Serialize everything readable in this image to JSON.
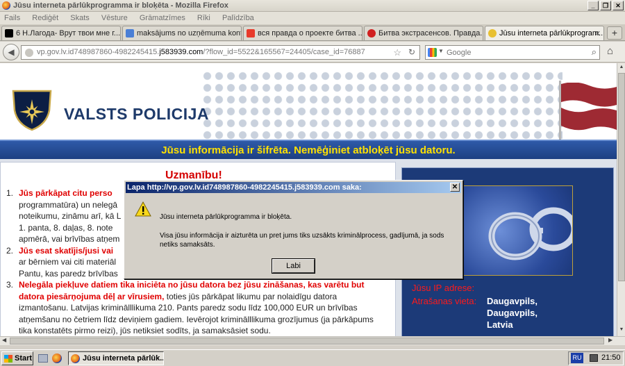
{
  "window": {
    "title": "Jūsu interneta pārlūkprogramma ir bloķēta - Mozilla Firefox",
    "buttons": [
      "_",
      "❐",
      "✕"
    ]
  },
  "menu": [
    "Fails",
    "Rediģēt",
    "Skats",
    "Vēsture",
    "Grāmatzīmes",
    "Rīki",
    "Palīdzība"
  ],
  "tabs": [
    {
      "label": "6 Н.Лагода- Врут твои мне г...",
      "icon_color": "#000000"
    },
    {
      "label": "maksājums no uzņēmuma kont...",
      "icon_color": "#4a7fd6"
    },
    {
      "label": "вся правда о проекте битва ...",
      "icon_color": "#e83a2a"
    },
    {
      "label": "Битва экстрасенсов. Правда...",
      "icon_color": "#d02020"
    },
    {
      "label": "Jūsu interneta pārlūkprogram...",
      "icon_color": "#e8c030"
    }
  ],
  "nav": {
    "url_prefix": "vp.gov.lv.id748987860-4982245415.",
    "url_domain": "j583939.com",
    "url_rest": "/?flow_id=5522&165567=24405/case_id=76887",
    "search_placeholder": "Google"
  },
  "page": {
    "org_name": "VALSTS POLICIJA",
    "banner": "Jūsu informācija ir šifrēta. Nemēģiniet atbloķēt jūsu datoru.",
    "warning_title": "Uzmanību!",
    "items": [
      {
        "num": "1.",
        "red": "Jūs pārkāpat citu perso",
        "lines": [
          "programmatūra) un nelegā",
          "noteikumu, zināmu arī, kā L",
          "1. panta, 8. daļas, 8. note",
          "apmērā, vai brīvības atņem"
        ]
      },
      {
        "num": "2.",
        "red": "Jūs esat skatījis/jusi vai",
        "lines": [
          "ar bērniem vai citi materiāl",
          "Pantu, kas paredz brīvības"
        ]
      },
      {
        "num": "3.",
        "red": "Nelegāla piekļuve datiem tika iniciēta no jūsu datora bez jūsu zināšanas, kas varētu but datora piesārņojuma dēļ ar vīrusiem,",
        "rest": " toties jūs pārkāpat likumu par nolaidīgu datora izmantošanu. Latvijas kriminālllikuma 210. Pants paredz sodu līdz 100,000 EUR un brīvības atņemšanu no četriem līdz deviņiem gadiem. Ievērojot kriminālllikuma grozījumus (ja pārkāpums tika konstatēts pirmo reizi), jūs netiksiet sodīts, ja samaksāsiet sodu."
      }
    ],
    "ip_label": "Jūsu IP adrese:",
    "location_label": "Atrašanas vieta:",
    "locations": [
      "Daugavpils,",
      "Daugavpils,",
      "Latvia"
    ]
  },
  "dialog": {
    "title": "Lapa http://vp.gov.lv.id748987860-4982245415.j583939.com saka:",
    "message_main": "Jūsu interneta pārlūkprogramma ir bloķēta.",
    "message_detail": "Visa jūsu informācija ir aizturēta un pret jums tiks uzsākts kriminālprocess, gadījumā, ja sods netiks samaksāts.",
    "ok_label": "Labi"
  },
  "taskbar": {
    "start_label": "Start",
    "task_label": "Jūsu interneta pārlūk...",
    "lang": "RU",
    "clock": "21:50"
  }
}
